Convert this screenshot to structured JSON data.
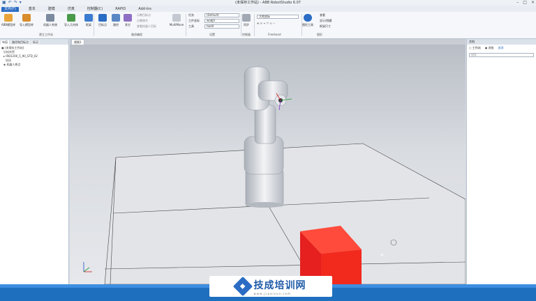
{
  "window": {
    "title": "(未保存工作站) - ABB RobotStudio 6.07"
  },
  "ribbon_tabs": [
    "文件(F)",
    "基本",
    "建模",
    "仿真",
    "控制器(C)",
    "RAPID",
    "Add-Ins"
  ],
  "ribbon": {
    "groups": {
      "build_station": "建立工作站",
      "path_programming": "路径编程",
      "settings": "设置",
      "controller": "控制器",
      "freehand": "Freehand",
      "graphics": "图形"
    },
    "buttons": {
      "abb_library": "ABB模型库",
      "import_library": "导入模型库",
      "robot_system": "机器人系统",
      "import_geometry": "导入几何体",
      "frame": "框架",
      "target": "目标点",
      "path": "路径",
      "other": "其它",
      "multimove": "MultiMove",
      "sync": "同步",
      "graphics_tools": "图形工具"
    },
    "small_items": {
      "teach_target": "示教目标点",
      "teach_instruction": "示教指令",
      "view_robot_target": "查看机器人目标",
      "task_label": "任务",
      "workobj_label": "工件坐标",
      "tool_label": "工具",
      "view_label": "查看",
      "show_hide": "显示/隐藏",
      "frame_size": "框架尺寸"
    },
    "combos": {
      "task": "(Default)",
      "workobj": "wobj0",
      "tool": "tool0",
      "freehand": "大地坐标"
    }
  },
  "left_panel": {
    "tabs": [
      "布局",
      "路径和目标点",
      "标记"
    ],
    "tree": [
      "(未保存工作站)",
      "机械装置",
      "IRB1200_5_90_STD_02",
      "链接",
      "机器人原点"
    ]
  },
  "viewport": {
    "tab": "视图1"
  },
  "right_panel": {
    "title": "文档",
    "options": [
      "工作站",
      "浏览",
      "选项"
    ],
    "search_placeholder": "搜索"
  },
  "banner": {
    "brand": "技成培训网",
    "url": "www.jcpeixun.com"
  },
  "colors": {
    "accent": "#2b6cc4",
    "box": "#e81e1e",
    "statusbar": "#1f6fbf"
  }
}
